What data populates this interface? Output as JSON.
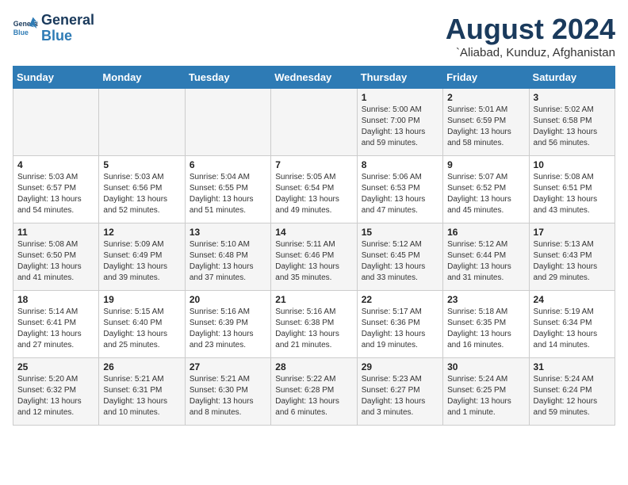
{
  "logo": {
    "line1": "General",
    "line2": "Blue"
  },
  "title": "August 2024",
  "location": "`Aliabad, Kunduz, Afghanistan",
  "days_of_week": [
    "Sunday",
    "Monday",
    "Tuesday",
    "Wednesday",
    "Thursday",
    "Friday",
    "Saturday"
  ],
  "weeks": [
    [
      {
        "num": "",
        "info": ""
      },
      {
        "num": "",
        "info": ""
      },
      {
        "num": "",
        "info": ""
      },
      {
        "num": "",
        "info": ""
      },
      {
        "num": "1",
        "info": "Sunrise: 5:00 AM\nSunset: 7:00 PM\nDaylight: 13 hours\nand 59 minutes."
      },
      {
        "num": "2",
        "info": "Sunrise: 5:01 AM\nSunset: 6:59 PM\nDaylight: 13 hours\nand 58 minutes."
      },
      {
        "num": "3",
        "info": "Sunrise: 5:02 AM\nSunset: 6:58 PM\nDaylight: 13 hours\nand 56 minutes."
      }
    ],
    [
      {
        "num": "4",
        "info": "Sunrise: 5:03 AM\nSunset: 6:57 PM\nDaylight: 13 hours\nand 54 minutes."
      },
      {
        "num": "5",
        "info": "Sunrise: 5:03 AM\nSunset: 6:56 PM\nDaylight: 13 hours\nand 52 minutes."
      },
      {
        "num": "6",
        "info": "Sunrise: 5:04 AM\nSunset: 6:55 PM\nDaylight: 13 hours\nand 51 minutes."
      },
      {
        "num": "7",
        "info": "Sunrise: 5:05 AM\nSunset: 6:54 PM\nDaylight: 13 hours\nand 49 minutes."
      },
      {
        "num": "8",
        "info": "Sunrise: 5:06 AM\nSunset: 6:53 PM\nDaylight: 13 hours\nand 47 minutes."
      },
      {
        "num": "9",
        "info": "Sunrise: 5:07 AM\nSunset: 6:52 PM\nDaylight: 13 hours\nand 45 minutes."
      },
      {
        "num": "10",
        "info": "Sunrise: 5:08 AM\nSunset: 6:51 PM\nDaylight: 13 hours\nand 43 minutes."
      }
    ],
    [
      {
        "num": "11",
        "info": "Sunrise: 5:08 AM\nSunset: 6:50 PM\nDaylight: 13 hours\nand 41 minutes."
      },
      {
        "num": "12",
        "info": "Sunrise: 5:09 AM\nSunset: 6:49 PM\nDaylight: 13 hours\nand 39 minutes."
      },
      {
        "num": "13",
        "info": "Sunrise: 5:10 AM\nSunset: 6:48 PM\nDaylight: 13 hours\nand 37 minutes."
      },
      {
        "num": "14",
        "info": "Sunrise: 5:11 AM\nSunset: 6:46 PM\nDaylight: 13 hours\nand 35 minutes."
      },
      {
        "num": "15",
        "info": "Sunrise: 5:12 AM\nSunset: 6:45 PM\nDaylight: 13 hours\nand 33 minutes."
      },
      {
        "num": "16",
        "info": "Sunrise: 5:12 AM\nSunset: 6:44 PM\nDaylight: 13 hours\nand 31 minutes."
      },
      {
        "num": "17",
        "info": "Sunrise: 5:13 AM\nSunset: 6:43 PM\nDaylight: 13 hours\nand 29 minutes."
      }
    ],
    [
      {
        "num": "18",
        "info": "Sunrise: 5:14 AM\nSunset: 6:41 PM\nDaylight: 13 hours\nand 27 minutes."
      },
      {
        "num": "19",
        "info": "Sunrise: 5:15 AM\nSunset: 6:40 PM\nDaylight: 13 hours\nand 25 minutes."
      },
      {
        "num": "20",
        "info": "Sunrise: 5:16 AM\nSunset: 6:39 PM\nDaylight: 13 hours\nand 23 minutes."
      },
      {
        "num": "21",
        "info": "Sunrise: 5:16 AM\nSunset: 6:38 PM\nDaylight: 13 hours\nand 21 minutes."
      },
      {
        "num": "22",
        "info": "Sunrise: 5:17 AM\nSunset: 6:36 PM\nDaylight: 13 hours\nand 19 minutes."
      },
      {
        "num": "23",
        "info": "Sunrise: 5:18 AM\nSunset: 6:35 PM\nDaylight: 13 hours\nand 16 minutes."
      },
      {
        "num": "24",
        "info": "Sunrise: 5:19 AM\nSunset: 6:34 PM\nDaylight: 13 hours\nand 14 minutes."
      }
    ],
    [
      {
        "num": "25",
        "info": "Sunrise: 5:20 AM\nSunset: 6:32 PM\nDaylight: 13 hours\nand 12 minutes."
      },
      {
        "num": "26",
        "info": "Sunrise: 5:21 AM\nSunset: 6:31 PM\nDaylight: 13 hours\nand 10 minutes."
      },
      {
        "num": "27",
        "info": "Sunrise: 5:21 AM\nSunset: 6:30 PM\nDaylight: 13 hours\nand 8 minutes."
      },
      {
        "num": "28",
        "info": "Sunrise: 5:22 AM\nSunset: 6:28 PM\nDaylight: 13 hours\nand 6 minutes."
      },
      {
        "num": "29",
        "info": "Sunrise: 5:23 AM\nSunset: 6:27 PM\nDaylight: 13 hours\nand 3 minutes."
      },
      {
        "num": "30",
        "info": "Sunrise: 5:24 AM\nSunset: 6:25 PM\nDaylight: 13 hours\nand 1 minute."
      },
      {
        "num": "31",
        "info": "Sunrise: 5:24 AM\nSunset: 6:24 PM\nDaylight: 12 hours\nand 59 minutes."
      }
    ]
  ]
}
